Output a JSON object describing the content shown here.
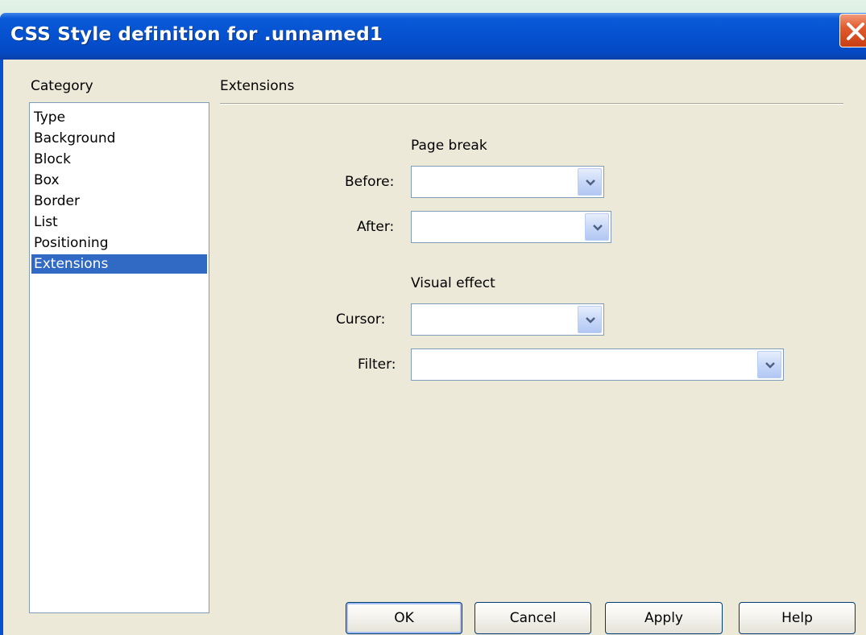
{
  "window": {
    "title": "CSS Style definition for .unnamed1"
  },
  "category": {
    "label": "Category",
    "items": [
      "Type",
      "Background",
      "Block",
      "Box",
      "Border",
      "List",
      "Positioning",
      "Extensions"
    ],
    "selected": "Extensions"
  },
  "panel": {
    "title": "Extensions",
    "page_break": {
      "heading": "Page break",
      "before_label": "Before:",
      "before_value": "",
      "after_label": "After:",
      "after_value": ""
    },
    "visual_effect": {
      "heading": "Visual effect",
      "cursor_label": "Cursor:",
      "cursor_value": "",
      "filter_label": "Filter:",
      "filter_value": ""
    }
  },
  "buttons": {
    "ok": "OK",
    "cancel": "Cancel",
    "apply": "Apply",
    "help": "Help"
  },
  "icons": {
    "close": "close-icon",
    "dropdown": "chevron-down-icon"
  },
  "colors": {
    "titlebar": "#0551d0",
    "selection": "#316ac5",
    "dialog_bg": "#ece9d8",
    "close_button": "#e25b2e"
  }
}
